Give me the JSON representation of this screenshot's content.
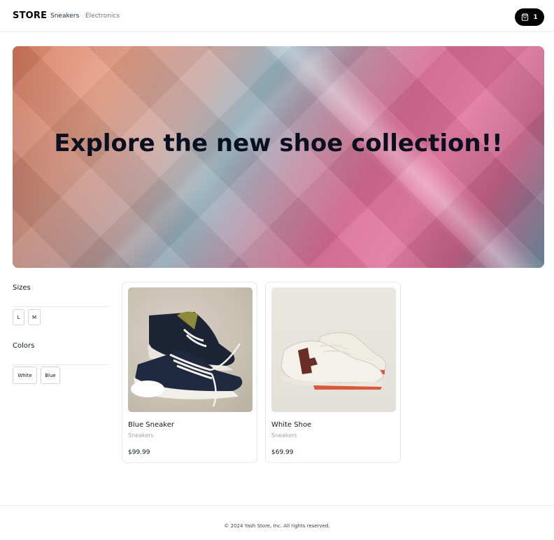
{
  "header": {
    "logo": "STORE",
    "nav": [
      {
        "label": "Sneakers"
      },
      {
        "label": "Electronics"
      }
    ],
    "cart": {
      "count": "1",
      "icon": "shopping-bag-icon"
    }
  },
  "hero": {
    "title": "Explore the new shoe collection!!"
  },
  "filters": {
    "sizes_heading": "Sizes",
    "sizes": [
      "L",
      "M"
    ],
    "colors_heading": "Colors",
    "colors": [
      "White",
      "Blue"
    ]
  },
  "products": [
    {
      "name": "Blue Sneaker",
      "category": "Sneakers",
      "price": "$99.99"
    },
    {
      "name": "White Shoe",
      "category": "Sneakers",
      "price": "$69.99"
    }
  ],
  "footer": {
    "text": "© 2024 Yash Store, Inc. All rights reserved."
  }
}
